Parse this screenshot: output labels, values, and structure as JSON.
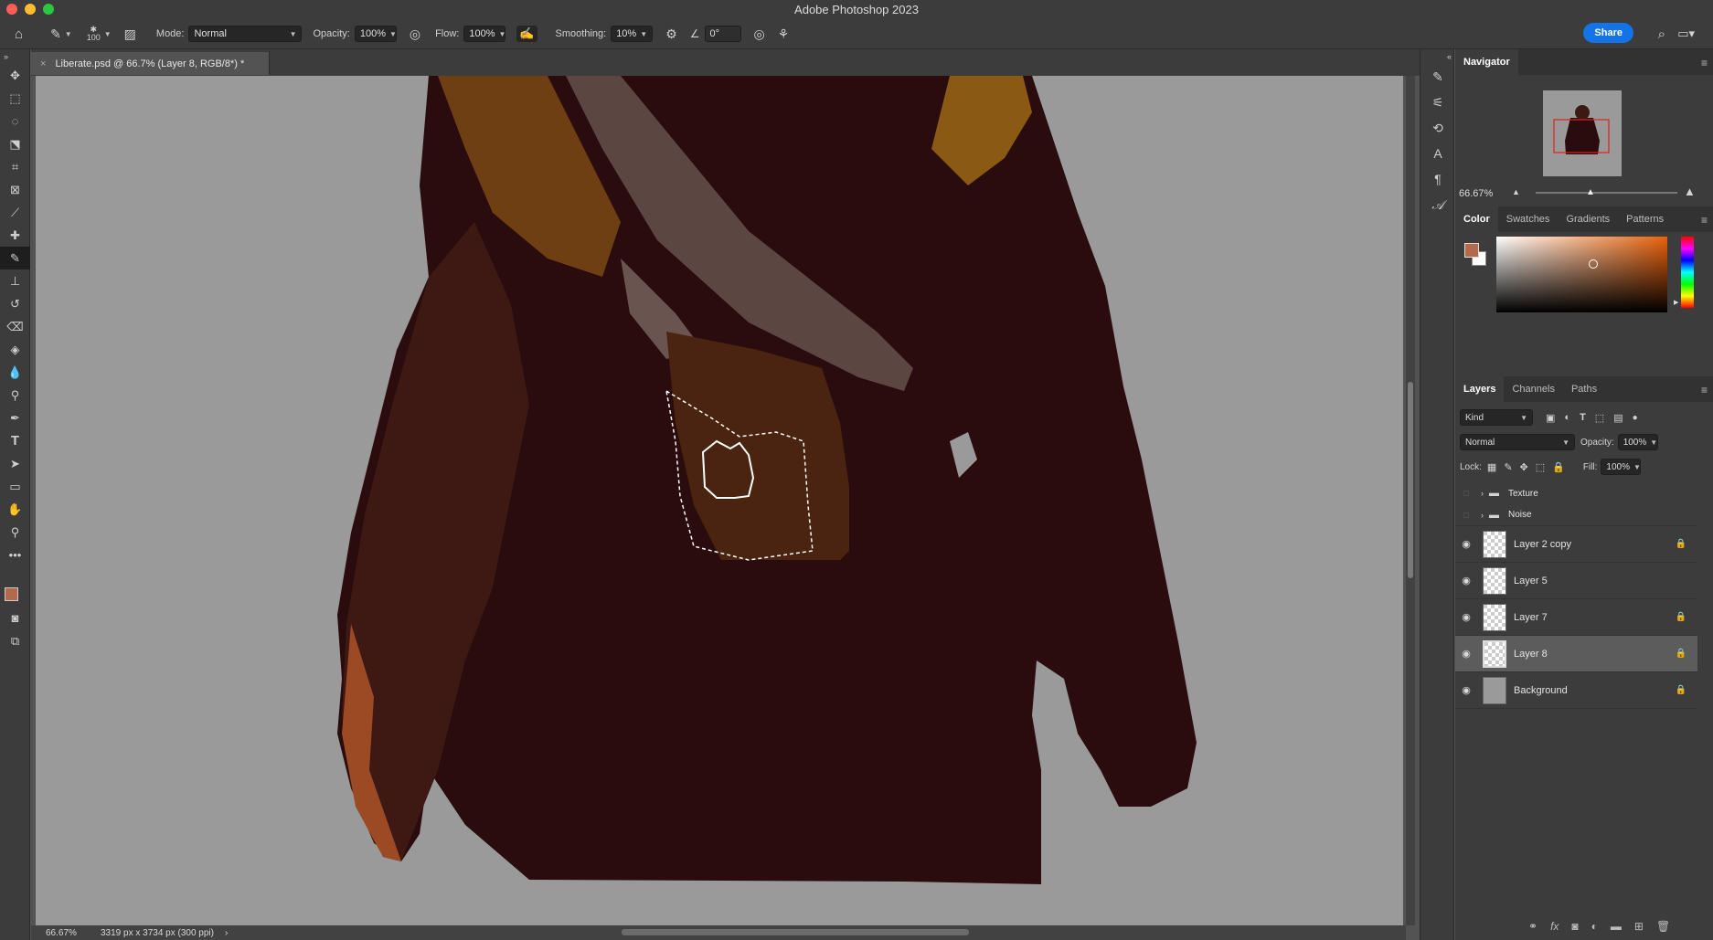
{
  "window": {
    "title": "Adobe Photoshop 2023"
  },
  "options": {
    "brush_size": "100",
    "mode_label": "Mode:",
    "mode_value": "Normal",
    "opacity_label": "Opacity:",
    "opacity_value": "100%",
    "flow_label": "Flow:",
    "flow_value": "100%",
    "smoothing_label": "Smoothing:",
    "smoothing_value": "10%",
    "angle_value": "0°",
    "share_label": "Share"
  },
  "document": {
    "tab_title": "Liberate.psd @ 66.7% (Layer 8, RGB/8*) *",
    "status_zoom": "66.67%",
    "status_info": "3319 px x 3734 px (300 ppi)"
  },
  "navigator": {
    "tab": "Navigator",
    "zoom": "66.67%"
  },
  "color_panel": {
    "tabs": [
      "Color",
      "Swatches",
      "Gradients",
      "Patterns"
    ],
    "foreground": "#b4694a",
    "background": "#ffffff"
  },
  "layers_panel": {
    "tabs": [
      "Layers",
      "Channels",
      "Paths"
    ],
    "filter_label": "Kind",
    "blend_mode": "Normal",
    "opacity_label": "Opacity:",
    "opacity_value": "100%",
    "lock_label": "Lock:",
    "fill_label": "Fill:",
    "fill_value": "100%",
    "groups": [
      "Texture",
      "Noise"
    ],
    "layers": [
      {
        "name": "Layer 2 copy",
        "locked": true,
        "selected": false
      },
      {
        "name": "Layer 5",
        "locked": false,
        "selected": false
      },
      {
        "name": "Layer 7",
        "locked": true,
        "selected": false
      },
      {
        "name": "Layer 8",
        "locked": true,
        "selected": true
      },
      {
        "name": "Background",
        "locked": true,
        "selected": false
      }
    ]
  },
  "colors": {
    "accent": "#1473e6",
    "canvas_bg": "#9a9a9a",
    "figure_dark": "#2a0c0e"
  }
}
